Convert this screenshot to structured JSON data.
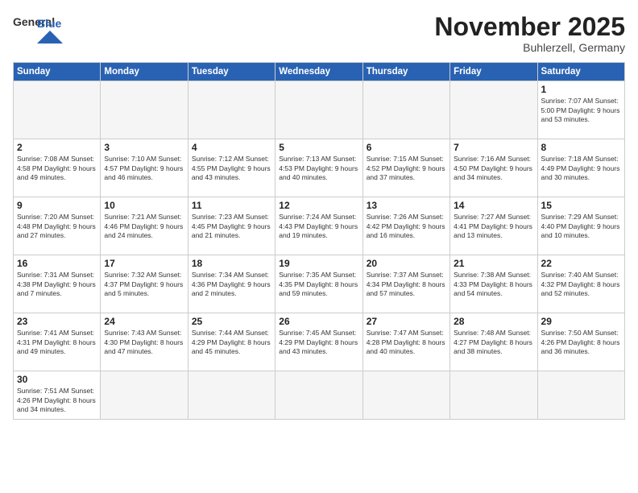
{
  "header": {
    "logo_general": "General",
    "logo_blue": "Blue",
    "month_title": "November 2025",
    "location": "Buhlerzell, Germany"
  },
  "days_of_week": [
    "Sunday",
    "Monday",
    "Tuesday",
    "Wednesday",
    "Thursday",
    "Friday",
    "Saturday"
  ],
  "weeks": [
    [
      {
        "day": "",
        "info": ""
      },
      {
        "day": "",
        "info": ""
      },
      {
        "day": "",
        "info": ""
      },
      {
        "day": "",
        "info": ""
      },
      {
        "day": "",
        "info": ""
      },
      {
        "day": "",
        "info": ""
      },
      {
        "day": "1",
        "info": "Sunrise: 7:07 AM\nSunset: 5:00 PM\nDaylight: 9 hours and 53 minutes."
      }
    ],
    [
      {
        "day": "2",
        "info": "Sunrise: 7:08 AM\nSunset: 4:58 PM\nDaylight: 9 hours and 49 minutes."
      },
      {
        "day": "3",
        "info": "Sunrise: 7:10 AM\nSunset: 4:57 PM\nDaylight: 9 hours and 46 minutes."
      },
      {
        "day": "4",
        "info": "Sunrise: 7:12 AM\nSunset: 4:55 PM\nDaylight: 9 hours and 43 minutes."
      },
      {
        "day": "5",
        "info": "Sunrise: 7:13 AM\nSunset: 4:53 PM\nDaylight: 9 hours and 40 minutes."
      },
      {
        "day": "6",
        "info": "Sunrise: 7:15 AM\nSunset: 4:52 PM\nDaylight: 9 hours and 37 minutes."
      },
      {
        "day": "7",
        "info": "Sunrise: 7:16 AM\nSunset: 4:50 PM\nDaylight: 9 hours and 34 minutes."
      },
      {
        "day": "8",
        "info": "Sunrise: 7:18 AM\nSunset: 4:49 PM\nDaylight: 9 hours and 30 minutes."
      }
    ],
    [
      {
        "day": "9",
        "info": "Sunrise: 7:20 AM\nSunset: 4:48 PM\nDaylight: 9 hours and 27 minutes."
      },
      {
        "day": "10",
        "info": "Sunrise: 7:21 AM\nSunset: 4:46 PM\nDaylight: 9 hours and 24 minutes."
      },
      {
        "day": "11",
        "info": "Sunrise: 7:23 AM\nSunset: 4:45 PM\nDaylight: 9 hours and 21 minutes."
      },
      {
        "day": "12",
        "info": "Sunrise: 7:24 AM\nSunset: 4:43 PM\nDaylight: 9 hours and 19 minutes."
      },
      {
        "day": "13",
        "info": "Sunrise: 7:26 AM\nSunset: 4:42 PM\nDaylight: 9 hours and 16 minutes."
      },
      {
        "day": "14",
        "info": "Sunrise: 7:27 AM\nSunset: 4:41 PM\nDaylight: 9 hours and 13 minutes."
      },
      {
        "day": "15",
        "info": "Sunrise: 7:29 AM\nSunset: 4:40 PM\nDaylight: 9 hours and 10 minutes."
      }
    ],
    [
      {
        "day": "16",
        "info": "Sunrise: 7:31 AM\nSunset: 4:38 PM\nDaylight: 9 hours and 7 minutes."
      },
      {
        "day": "17",
        "info": "Sunrise: 7:32 AM\nSunset: 4:37 PM\nDaylight: 9 hours and 5 minutes."
      },
      {
        "day": "18",
        "info": "Sunrise: 7:34 AM\nSunset: 4:36 PM\nDaylight: 9 hours and 2 minutes."
      },
      {
        "day": "19",
        "info": "Sunrise: 7:35 AM\nSunset: 4:35 PM\nDaylight: 8 hours and 59 minutes."
      },
      {
        "day": "20",
        "info": "Sunrise: 7:37 AM\nSunset: 4:34 PM\nDaylight: 8 hours and 57 minutes."
      },
      {
        "day": "21",
        "info": "Sunrise: 7:38 AM\nSunset: 4:33 PM\nDaylight: 8 hours and 54 minutes."
      },
      {
        "day": "22",
        "info": "Sunrise: 7:40 AM\nSunset: 4:32 PM\nDaylight: 8 hours and 52 minutes."
      }
    ],
    [
      {
        "day": "23",
        "info": "Sunrise: 7:41 AM\nSunset: 4:31 PM\nDaylight: 8 hours and 49 minutes."
      },
      {
        "day": "24",
        "info": "Sunrise: 7:43 AM\nSunset: 4:30 PM\nDaylight: 8 hours and 47 minutes."
      },
      {
        "day": "25",
        "info": "Sunrise: 7:44 AM\nSunset: 4:29 PM\nDaylight: 8 hours and 45 minutes."
      },
      {
        "day": "26",
        "info": "Sunrise: 7:45 AM\nSunset: 4:29 PM\nDaylight: 8 hours and 43 minutes."
      },
      {
        "day": "27",
        "info": "Sunrise: 7:47 AM\nSunset: 4:28 PM\nDaylight: 8 hours and 40 minutes."
      },
      {
        "day": "28",
        "info": "Sunrise: 7:48 AM\nSunset: 4:27 PM\nDaylight: 8 hours and 38 minutes."
      },
      {
        "day": "29",
        "info": "Sunrise: 7:50 AM\nSunset: 4:26 PM\nDaylight: 8 hours and 36 minutes."
      }
    ],
    [
      {
        "day": "30",
        "info": "Sunrise: 7:51 AM\nSunset: 4:26 PM\nDaylight: 8 hours and 34 minutes."
      },
      {
        "day": "",
        "info": ""
      },
      {
        "day": "",
        "info": ""
      },
      {
        "day": "",
        "info": ""
      },
      {
        "day": "",
        "info": ""
      },
      {
        "day": "",
        "info": ""
      },
      {
        "day": "",
        "info": ""
      }
    ]
  ]
}
